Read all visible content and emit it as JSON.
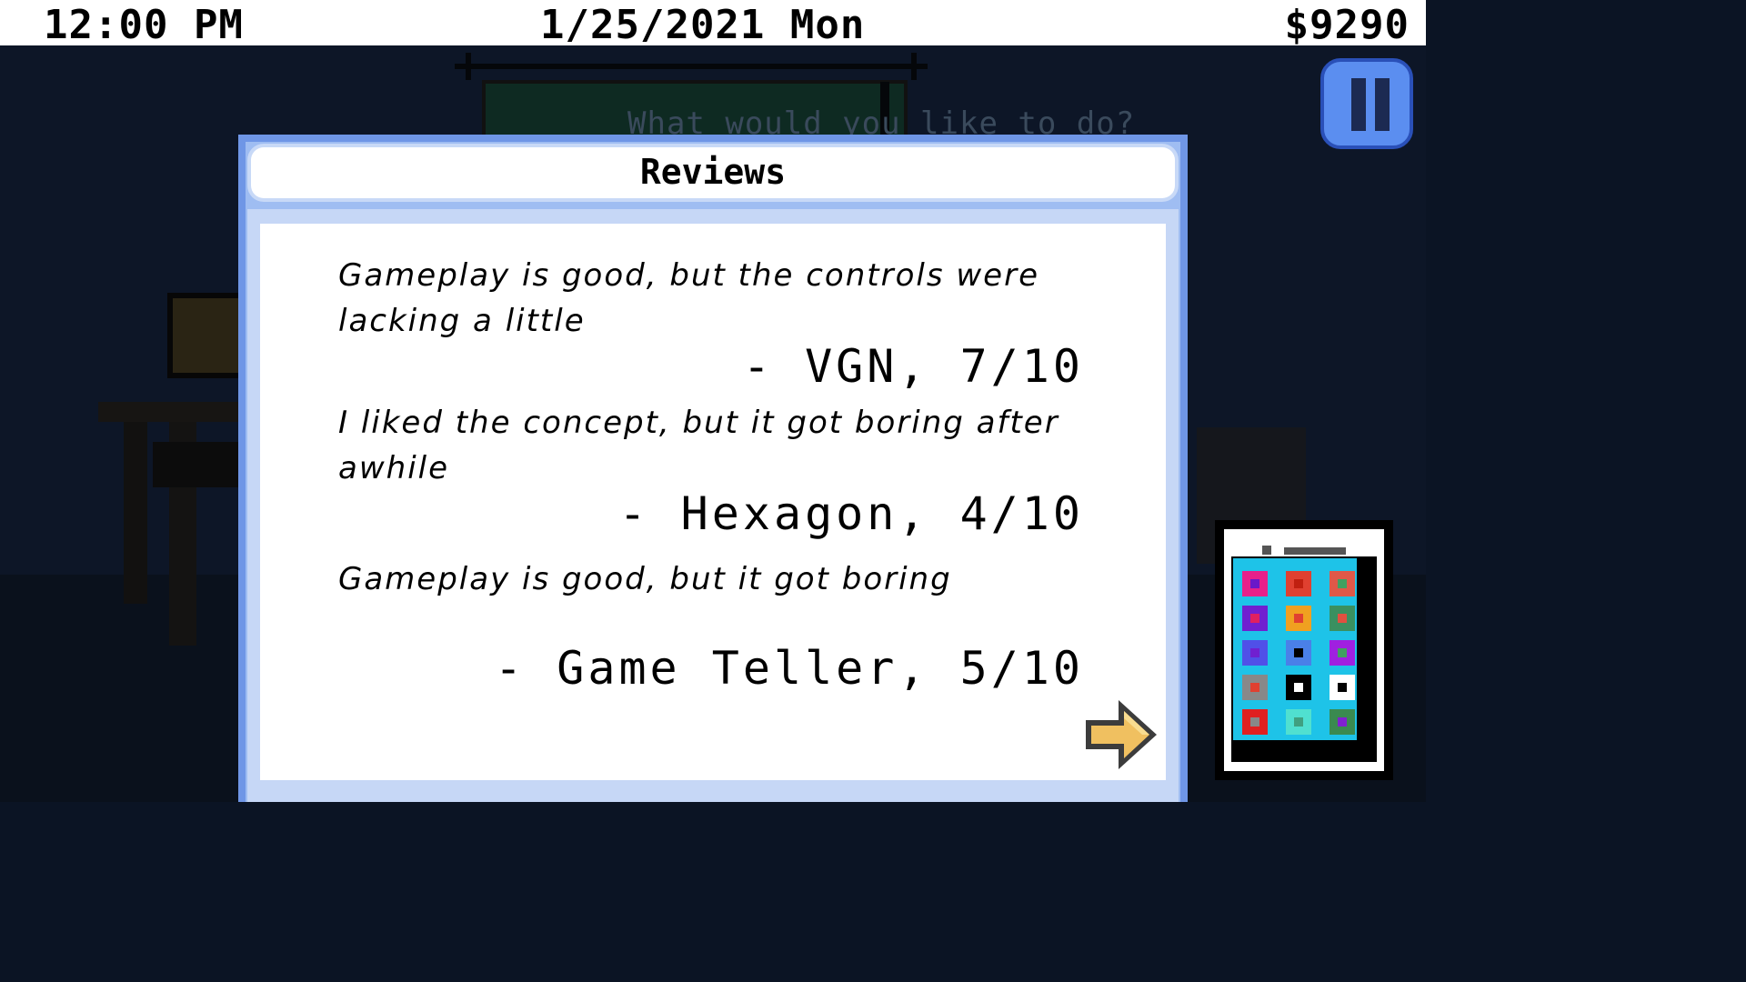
{
  "status_bar": {
    "time": "12:00 PM",
    "date": "1/25/2021 Mon",
    "money": "$9290"
  },
  "scene": {
    "prompt": "What would you like to do?"
  },
  "dialog": {
    "title": "Reviews",
    "reviews": [
      {
        "quote": " Gameplay is good, but the controls were lacking a little",
        "source": "- VGN, 7/10"
      },
      {
        "quote": "I liked the concept, but it got boring after awhile",
        "source": "- Hexagon, 4/10"
      },
      {
        "quote": "Gameplay is good, but it got boring",
        "source": "- Game Teller, 5/10"
      }
    ]
  },
  "controls": {
    "pause_icon": "pause-icon",
    "next_icon": "next-arrow-icon",
    "phone_icon": "phone-icon"
  },
  "colors": {
    "dialog_border": "#6f96e6",
    "pause_button": "#5b8ef0",
    "arrow": "#f0c060",
    "phone_screen": "#1ec3e8"
  },
  "phone_apps": [
    {
      "bg": "#e8208a",
      "dot": "#6a18c8"
    },
    {
      "bg": "#e04030",
      "dot": "#c02010"
    },
    {
      "bg": "#e05848",
      "dot": "#40a060"
    },
    {
      "bg": "#7020d0",
      "dot": "#e02060"
    },
    {
      "bg": "#f0a020",
      "dot": "#e04030"
    },
    {
      "bg": "#3a9060",
      "dot": "#e05040"
    },
    {
      "bg": "#5050e8",
      "dot": "#7020d0"
    },
    {
      "bg": "#4a80e8",
      "dot": "#000000"
    },
    {
      "bg": "#a020e0",
      "dot": "#40a060"
    },
    {
      "bg": "#888888",
      "dot": "#e04030"
    },
    {
      "bg": "#000000",
      "dot": "#ffffff"
    },
    {
      "bg": "#ffffff",
      "dot": "#000000"
    },
    {
      "bg": "#e02020",
      "dot": "#888888"
    },
    {
      "bg": "#50e0d0",
      "dot": "#40a080"
    },
    {
      "bg": "#3a8a50",
      "dot": "#8020d0"
    }
  ]
}
